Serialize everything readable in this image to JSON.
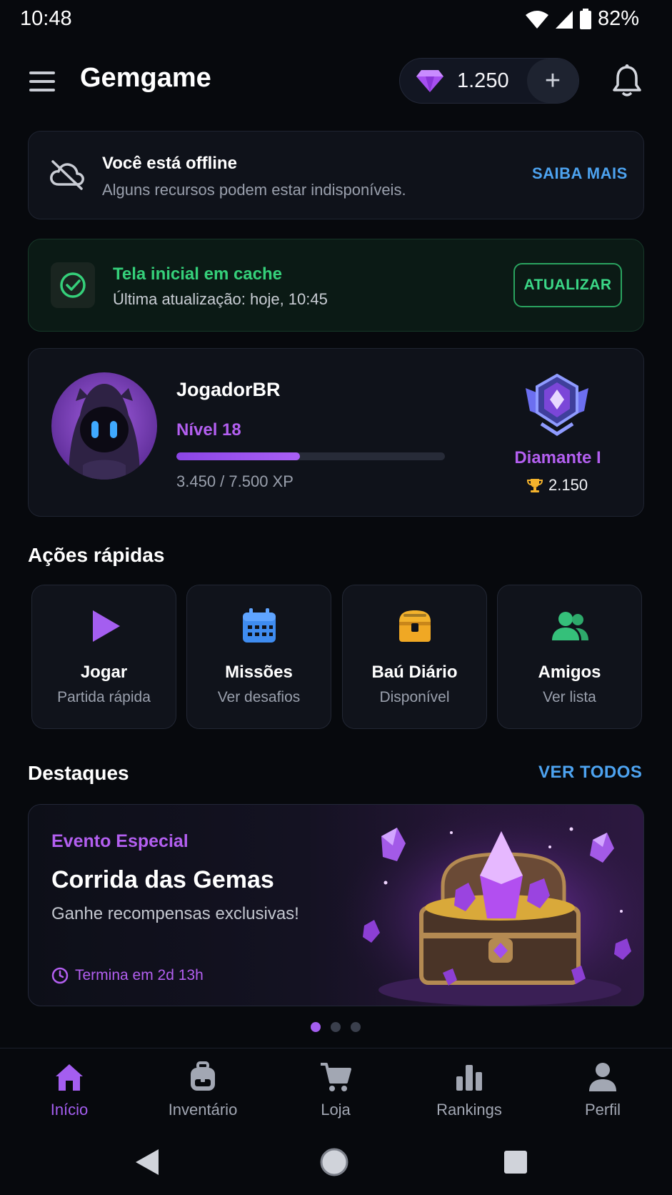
{
  "status_bar": {
    "time": "10:48",
    "battery": "82%"
  },
  "app_bar": {
    "title": "Gemgame",
    "gems": "1.250",
    "add_label": "+"
  },
  "offline_banner": {
    "title": "Você está offline",
    "subtitle": "Alguns recursos podem estar indisponíveis.",
    "action": "SAIBA MAIS"
  },
  "cache_banner": {
    "title": "Tela inicial em cache",
    "subtitle": "Última atualização: hoje, 10:45",
    "action": "ATUALIZAR"
  },
  "profile": {
    "name": "JogadorBR",
    "level": "Nível 18",
    "xp_text": "3.450 / 7.500 XP",
    "xp_fraction": 0.46,
    "rank": "Diamante I",
    "trophies": "2.150"
  },
  "quick_actions": {
    "title": "Ações rápidas",
    "items": [
      {
        "label": "Jogar",
        "sub": "Partida rápida",
        "icon": "play-icon"
      },
      {
        "label": "Missões",
        "sub": "Ver desafios",
        "icon": "calendar-icon"
      },
      {
        "label": "Baú Diário",
        "sub": "Disponível",
        "icon": "chest-icon"
      },
      {
        "label": "Amigos",
        "sub": "Ver lista",
        "icon": "friends-icon"
      }
    ]
  },
  "highlights": {
    "title": "Destaques",
    "see_all": "VER TODOS",
    "banner": {
      "tag": "Evento Especial",
      "title": "Corrida das Gemas",
      "subtitle": "Ganhe recompensas exclusivas!",
      "timer": "Termina em 2d 13h"
    },
    "pages": 3,
    "active_page": 1
  },
  "bottom_nav": {
    "items": [
      {
        "label": "Início",
        "icon": "home-icon",
        "active": true
      },
      {
        "label": "Inventário",
        "icon": "backpack-icon",
        "active": false
      },
      {
        "label": "Loja",
        "icon": "cart-icon",
        "active": false
      },
      {
        "label": "Rankings",
        "icon": "bar-chart-icon",
        "active": false
      },
      {
        "label": "Perfil",
        "icon": "person-icon",
        "active": false
      }
    ]
  },
  "colors": {
    "accent_purple": "#a45ef0",
    "link_blue": "#4da3f0",
    "success_green": "#35d07a",
    "background": "#07090d"
  }
}
